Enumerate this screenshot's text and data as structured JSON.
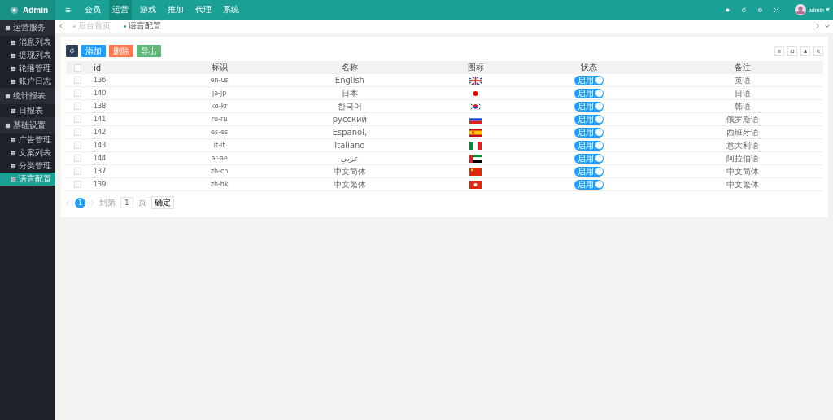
{
  "brand": "Admin",
  "top_nav": [
    {
      "label": "会员",
      "selected": false
    },
    {
      "label": "运营",
      "selected": true
    },
    {
      "label": "游戏",
      "selected": false
    },
    {
      "label": "推加",
      "selected": false
    },
    {
      "label": "代理",
      "selected": false
    },
    {
      "label": "系统",
      "selected": false
    }
  ],
  "user": "admin",
  "sidebar": [
    {
      "label": "运营服务",
      "children": [
        {
          "label": "消息列表",
          "selected": false
        },
        {
          "label": "提现列表",
          "selected": false
        },
        {
          "label": "轮播管理",
          "selected": false
        },
        {
          "label": "账户日志",
          "selected": false
        }
      ]
    },
    {
      "label": "统计报表",
      "children": [
        {
          "label": "日报表",
          "selected": false
        }
      ]
    },
    {
      "label": "基础设置",
      "children": [
        {
          "label": "广告管理",
          "selected": false
        },
        {
          "label": "文案列表",
          "selected": false
        },
        {
          "label": "分类管理",
          "selected": false
        },
        {
          "label": "语言配置",
          "selected": true
        }
      ]
    }
  ],
  "page_tabs": [
    {
      "label": "后台首页",
      "selected": false
    },
    {
      "label": "语言配置",
      "selected": true
    }
  ],
  "toolbar": [
    {
      "label": "添加",
      "kind": "add"
    },
    {
      "label": "删除",
      "kind": "delete"
    },
    {
      "label": "导出",
      "kind": "export"
    }
  ],
  "table": {
    "select_all_checked": false,
    "columns": [
      "id",
      "标识",
      "名称",
      "图标",
      "状态",
      "备注"
    ],
    "rows": [
      {
        "id": "136",
        "code": "en-us",
        "name": "English",
        "status": {
          "label": "启用",
          "on": true
        },
        "note": "英语",
        "checked": false
      },
      {
        "id": "140",
        "code": "ja-jp",
        "name": "日本",
        "status": {
          "label": "启用",
          "on": true
        },
        "note": "日语",
        "checked": false
      },
      {
        "id": "138",
        "code": "ko-kr",
        "name": "한국어",
        "status": {
          "label": "启用",
          "on": true
        },
        "note": "韩语",
        "checked": false
      },
      {
        "id": "141",
        "code": "ru-ru",
        "name": "русский",
        "status": {
          "label": "启用",
          "on": true
        },
        "note": "俄罗斯语",
        "checked": false
      },
      {
        "id": "142",
        "code": "es-es",
        "name": "Español,",
        "status": {
          "label": "启用",
          "on": true
        },
        "note": "西班牙语",
        "checked": false
      },
      {
        "id": "143",
        "code": "it-it",
        "name": "Italiano",
        "status": {
          "label": "启用",
          "on": true
        },
        "note": "意大利语",
        "checked": false
      },
      {
        "id": "144",
        "code": "ar-ae",
        "name": "عربي",
        "status": {
          "label": "启用",
          "on": true
        },
        "note": "阿拉伯语",
        "checked": false
      },
      {
        "id": "137",
        "code": "zh-cn",
        "name": "中文简体",
        "status": {
          "label": "启用",
          "on": true
        },
        "note": "中文简体",
        "checked": false
      },
      {
        "id": "139",
        "code": "zh-hk",
        "name": "中文繁体",
        "status": {
          "label": "启用",
          "on": true
        },
        "note": "中文繁体",
        "checked": false
      }
    ]
  },
  "pagination": {
    "pages": [
      {
        "label": "1",
        "selected": true
      }
    ],
    "goto_label": "到第",
    "goto_value": "1",
    "page_unit": "页",
    "confirm": "确定"
  }
}
